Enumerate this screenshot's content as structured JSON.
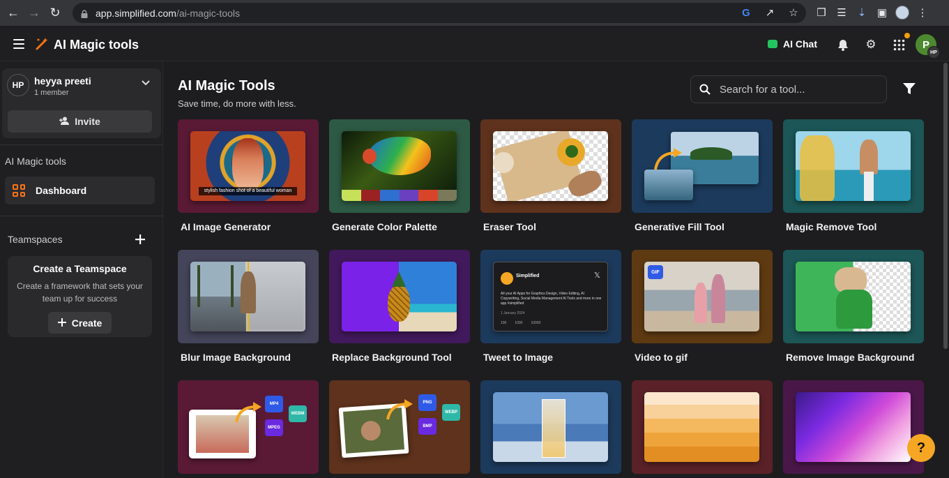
{
  "browser": {
    "url_host": "app.simplified.com",
    "url_path": "/ai-magic-tools"
  },
  "header": {
    "brand_title": "AI Magic tools",
    "ai_chat_label": "AI Chat",
    "avatar_initial": "P",
    "avatar_badge": "HP"
  },
  "sidebar": {
    "team_avatar": "HP",
    "team_name": "heyya preeti",
    "team_members": "1 member",
    "invite_label": "Invite",
    "section_title": "AI Magic tools",
    "dashboard_label": "Dashboard",
    "teamspaces_label": "Teamspaces",
    "create_box": {
      "title": "Create a Teamspace",
      "description": "Create a framework that sets your team up for success",
      "button_label": "Create"
    }
  },
  "main": {
    "title": "AI Magic Tools",
    "subtitle": "Save time, do more with less.",
    "search_placeholder": "Search for a tool...",
    "tools": [
      {
        "label": "AI Image Generator",
        "bg": "#5a1a35",
        "caption": "stylish fashion shot of a beautiful woman"
      },
      {
        "label": "Generate Color Palette",
        "bg": "#2d5a44"
      },
      {
        "label": "Eraser Tool",
        "bg": "#5e321c"
      },
      {
        "label": "Generative Fill Tool",
        "bg": "#1c3a5c"
      },
      {
        "label": "Magic Remove Tool",
        "bg": "#1c5656"
      },
      {
        "label": "Blur Image Background",
        "bg": "#44445a"
      },
      {
        "label": "Replace Background Tool",
        "bg": "#42195c"
      },
      {
        "label": "Tweet to Image",
        "bg": "#1c3a5c",
        "tweet": {
          "name": "Simplified",
          "body": "All your AI Apps for Graphics Design, Video Editing, AI Copywriting, Social Media Management AI Tools and more in one app #simplified",
          "date": "1 January 2024",
          "stats": [
            "100",
            "1000",
            "10000"
          ]
        }
      },
      {
        "label": "Video to gif",
        "bg": "#5e3a12",
        "badge": "GIF"
      },
      {
        "label": "Remove Image Background",
        "bg": "#1c5656"
      },
      {
        "label": "",
        "bg": "#5a1a35",
        "formats": [
          "MP4",
          "MPEG",
          "WEBM"
        ]
      },
      {
        "label": "",
        "bg": "#5e321c",
        "formats": [
          "PNG",
          "BMP",
          "WEBP"
        ]
      },
      {
        "label": "",
        "bg": "#1c3a5c"
      },
      {
        "label": "",
        "bg": "#5a2228"
      },
      {
        "label": "",
        "bg": "#4a1848"
      }
    ]
  },
  "help_label": "?",
  "colors": {
    "accent": "#f97316",
    "help": "#f5a623",
    "chat": "#22c55e",
    "avatar": "#4d8a2f"
  }
}
